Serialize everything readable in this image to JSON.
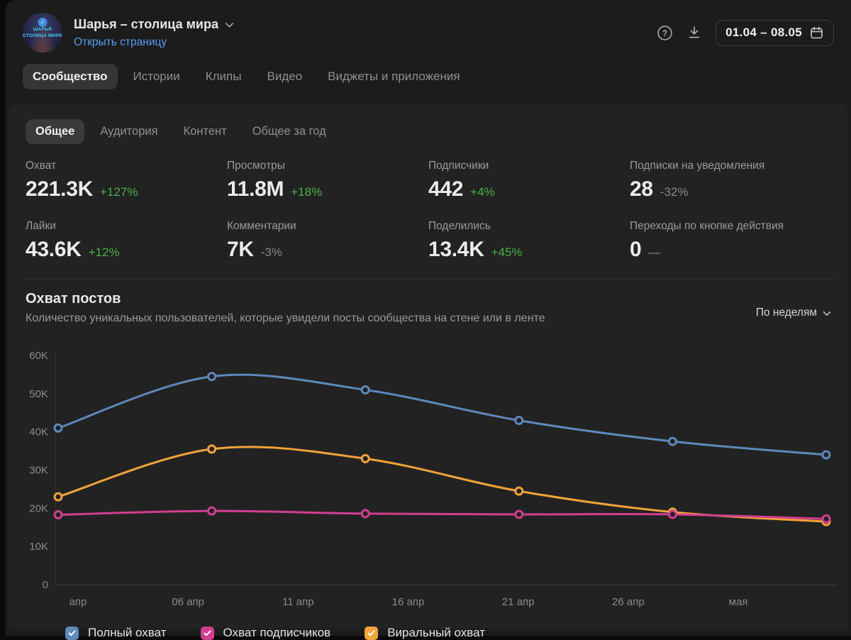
{
  "header": {
    "community_name": "Шарья – столица мира",
    "open_page_link": "Открыть страницу",
    "avatar_text_line1": "ШАРЬЯ",
    "avatar_text_line2": "СТОЛИЦА МИРА",
    "date_range": "01.04 – 08.05"
  },
  "icons": {
    "title_chevron": "chevron-down",
    "help": "question-circle",
    "download": "download-arrow",
    "calendar": "calendar",
    "select_chevron": "chevron-down",
    "legend_check": "checkmark",
    "avatar_badge": "verified-check"
  },
  "primary_tabs": {
    "active": 0,
    "items": [
      "Сообщество",
      "Истории",
      "Клипы",
      "Видео",
      "Виджеты и приложения"
    ]
  },
  "secondary_tabs": {
    "active": 0,
    "items": [
      "Общее",
      "Аудитория",
      "Контент",
      "Общее за год"
    ]
  },
  "stats": [
    {
      "label": "Охват",
      "value": "221.3K",
      "delta": "+127%",
      "trend": "up"
    },
    {
      "label": "Просмотры",
      "value": "11.8M",
      "delta": "+18%",
      "trend": "up"
    },
    {
      "label": "Подписчики",
      "value": "442",
      "delta": "+4%",
      "trend": "up"
    },
    {
      "label": "Подписки на уведомления",
      "value": "28",
      "delta": "-32%",
      "trend": "down"
    },
    {
      "label": "Лайки",
      "value": "43.6K",
      "delta": "+12%",
      "trend": "up"
    },
    {
      "label": "Комментарии",
      "value": "7K",
      "delta": "-3%",
      "trend": "down"
    },
    {
      "label": "Поделились",
      "value": "13.4K",
      "delta": "+45%",
      "trend": "up"
    },
    {
      "label": "Переходы по кнопке действия",
      "value": "0",
      "delta": "—",
      "trend": "none"
    }
  ],
  "colors": {
    "positive_green": "#4bb34b",
    "neutral_gray": "#8a8a8a",
    "link_blue": "#5a9df0",
    "card_bg": "#222222"
  },
  "chart_data": {
    "type": "line",
    "title": "Охват постов",
    "subtitle": "Количество уникальных пользователей, которые увидели посты сообщества на стене или в ленте",
    "granularity_selector": "По неделям",
    "x_tick_labels": [
      "апр",
      "06 апр",
      "11 апр",
      "16 апр",
      "21 апр",
      "26 апр",
      "мая"
    ],
    "y_tick_values": [
      0,
      10000,
      20000,
      30000,
      40000,
      50000,
      60000
    ],
    "y_tick_labels": [
      "0",
      "10K",
      "20K",
      "30K",
      "40K",
      "50K",
      "60K"
    ],
    "ylim": [
      0,
      60000
    ],
    "grid": "baseline-only",
    "legend_position": "bottom",
    "marker": "open-circle",
    "series": [
      {
        "name": "Полный охват",
        "color": "#5d89bd",
        "values": [
          41000,
          54500,
          51000,
          43000,
          37500,
          34000
        ]
      },
      {
        "name": "Охват подписчиков",
        "color": "#d23f8f",
        "values": [
          18300,
          19300,
          18600,
          18400,
          18400,
          17200
        ]
      },
      {
        "name": "Виральный охват",
        "color": "#f2a33a",
        "values": [
          23000,
          35500,
          33000,
          24500,
          19000,
          16500
        ]
      }
    ]
  }
}
